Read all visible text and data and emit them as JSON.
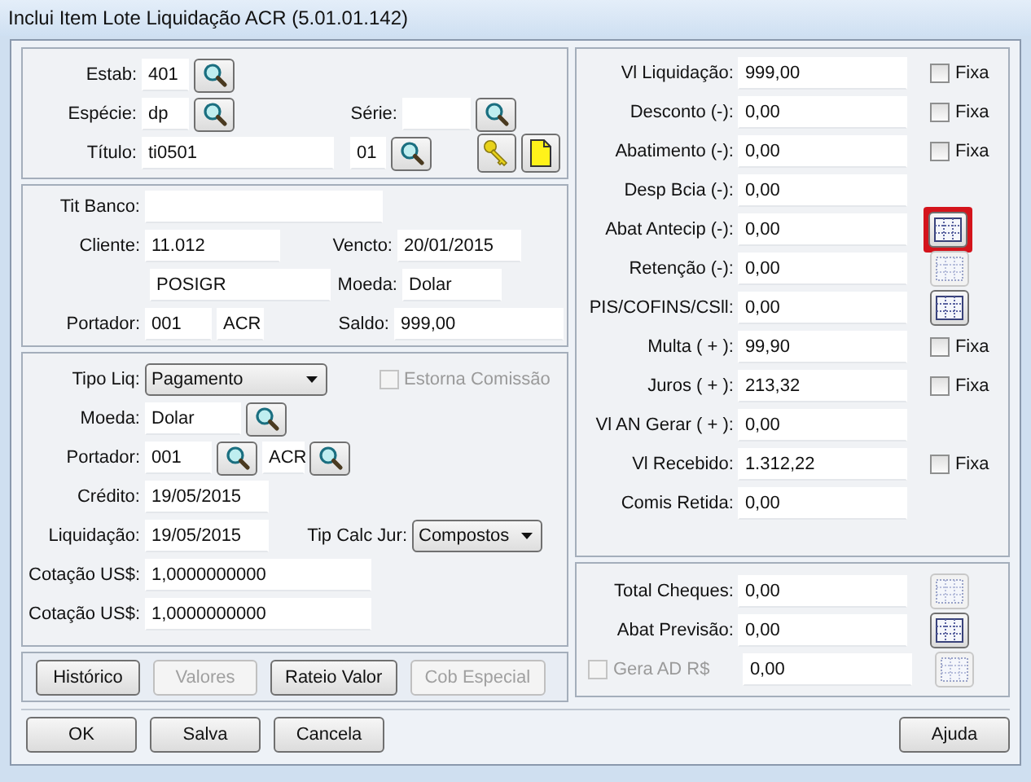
{
  "window": {
    "title": "Inclui Item Lote Liquidação ACR (5.01.01.142)"
  },
  "titulo": {
    "estab": {
      "label": "Estab:",
      "value": "401"
    },
    "especie": {
      "label": "Espécie:",
      "value": "dp"
    },
    "serie": {
      "label": "Série:"
    },
    "titulo": {
      "label": "Título:",
      "value": "ti0501"
    },
    "parcela": {
      "value": "01"
    }
  },
  "cliente": {
    "tit_banco": {
      "label": "Tit Banco:"
    },
    "cliente": {
      "label": "Cliente:",
      "value": "11.012"
    },
    "vencto": {
      "label": "Vencto:",
      "value": "20/01/2015"
    },
    "nome": {
      "value": "POSIGR"
    },
    "moeda": {
      "label": "Moeda:",
      "value": "Dolar"
    },
    "portador": {
      "label": "Portador:",
      "value": "001"
    },
    "carteira": {
      "value": "ACR"
    },
    "saldo": {
      "label": "Saldo:",
      "value": "999,00"
    }
  },
  "liquidacao": {
    "tipo_liq": {
      "label": "Tipo Liq:",
      "value": "Pagamento"
    },
    "estorna_comissao": {
      "label": "Estorna Comissão",
      "checked": false,
      "disabled": true
    },
    "moeda": {
      "label": "Moeda:",
      "value": "Dolar"
    },
    "portador": {
      "label": "Portador:",
      "value": "001"
    },
    "carteira": {
      "value": "ACR"
    },
    "credito": {
      "label": "Crédito:",
      "value": "19/05/2015"
    },
    "liquidacao": {
      "label": "Liquidação:",
      "value": "19/05/2015"
    },
    "tip_calc_jur": {
      "label": "Tip Calc Jur:",
      "value": "Compostos"
    },
    "cotacoes": [
      {
        "label": "Cotação US$:",
        "value": "1,0000000000"
      },
      {
        "label": "Cotação US$:",
        "value": "1,0000000000"
      }
    ]
  },
  "action_buttons": [
    {
      "label": "Histórico",
      "disabled": false
    },
    {
      "label": "Valores",
      "disabled": true
    },
    {
      "label": "Rateio Valor",
      "disabled": false
    },
    {
      "label": "Cob Especial",
      "disabled": true
    }
  ],
  "valores": [
    {
      "label": "Vl Liquidação:",
      "value": "999,00",
      "kind": "fixa",
      "option": "Fixa",
      "checked": false
    },
    {
      "label": "Desconto (-):",
      "value": "0,00",
      "kind": "fixa",
      "option": "Fixa",
      "checked": false
    },
    {
      "label": "Abatimento (-):",
      "value": "0,00",
      "kind": "fixa",
      "option": "Fixa",
      "checked": false
    },
    {
      "label": "Desp Bcia (-):",
      "value": "0,00",
      "kind": "plain"
    },
    {
      "label": "Abat Antecip (-):",
      "value": "0,00",
      "kind": "grid",
      "disabled": false,
      "highlighted": true
    },
    {
      "label": "Retenção (-):",
      "value": "0,00",
      "kind": "grid",
      "disabled": true,
      "highlighted": false
    },
    {
      "label": "PIS/COFINS/CSll:",
      "value": "0,00",
      "kind": "grid",
      "disabled": false,
      "highlighted": false
    },
    {
      "label": "Multa ( + ):",
      "value": "99,90",
      "kind": "fixa",
      "option": "Fixa",
      "checked": false
    },
    {
      "label": "Juros ( + ):",
      "value": "213,32",
      "kind": "fixa",
      "option": "Fixa",
      "checked": false
    },
    {
      "label": "Vl AN Gerar ( + ):",
      "value": "0,00",
      "kind": "plain"
    },
    {
      "label": "Vl Recebido:",
      "value": "1.312,22",
      "kind": "fixa",
      "option": "Fixa",
      "checked": false
    },
    {
      "label": "Comis Retida:",
      "value": "0,00",
      "kind": "plain"
    }
  ],
  "totais": [
    {
      "label": "Total Cheques:",
      "value": "0,00",
      "kind": "label",
      "grid_disabled": true
    },
    {
      "label": "Abat Previsão:",
      "value": "0,00",
      "kind": "label",
      "grid_disabled": false
    },
    {
      "label": "Gera AD R$",
      "value": "0,00",
      "kind": "check",
      "checked": false,
      "disabled": true,
      "grid_disabled": true
    }
  ],
  "dialog_buttons": [
    {
      "label": "OK"
    },
    {
      "label": "Salva"
    },
    {
      "label": "Cancela"
    },
    {
      "label": "Ajuda"
    }
  ]
}
